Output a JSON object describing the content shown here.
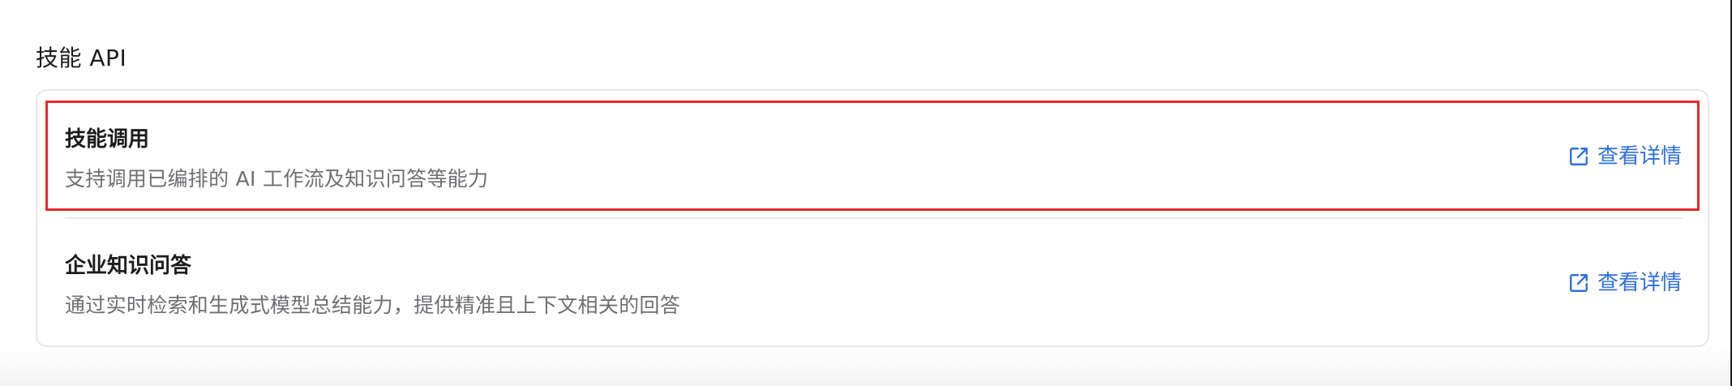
{
  "section": {
    "title": "技能 API"
  },
  "items": [
    {
      "title": "技能调用",
      "description": "支持调用已编排的 AI 工作流及知识问答等能力",
      "link_label": "查看详情",
      "link_icon": "external-link-icon",
      "highlighted": true
    },
    {
      "title": "企业知识问答",
      "description": "通过实时检索和生成式模型总结能力，提供精准且上下文相关的回答",
      "link_label": "查看详情",
      "link_icon": "external-link-icon",
      "highlighted": false
    }
  ],
  "colors": {
    "link": "#2f6fe0",
    "highlight_border": "#e8282b",
    "card_border": "#e6e7ea",
    "title_text": "#1c1c1e",
    "description_text": "#6e6f73"
  }
}
